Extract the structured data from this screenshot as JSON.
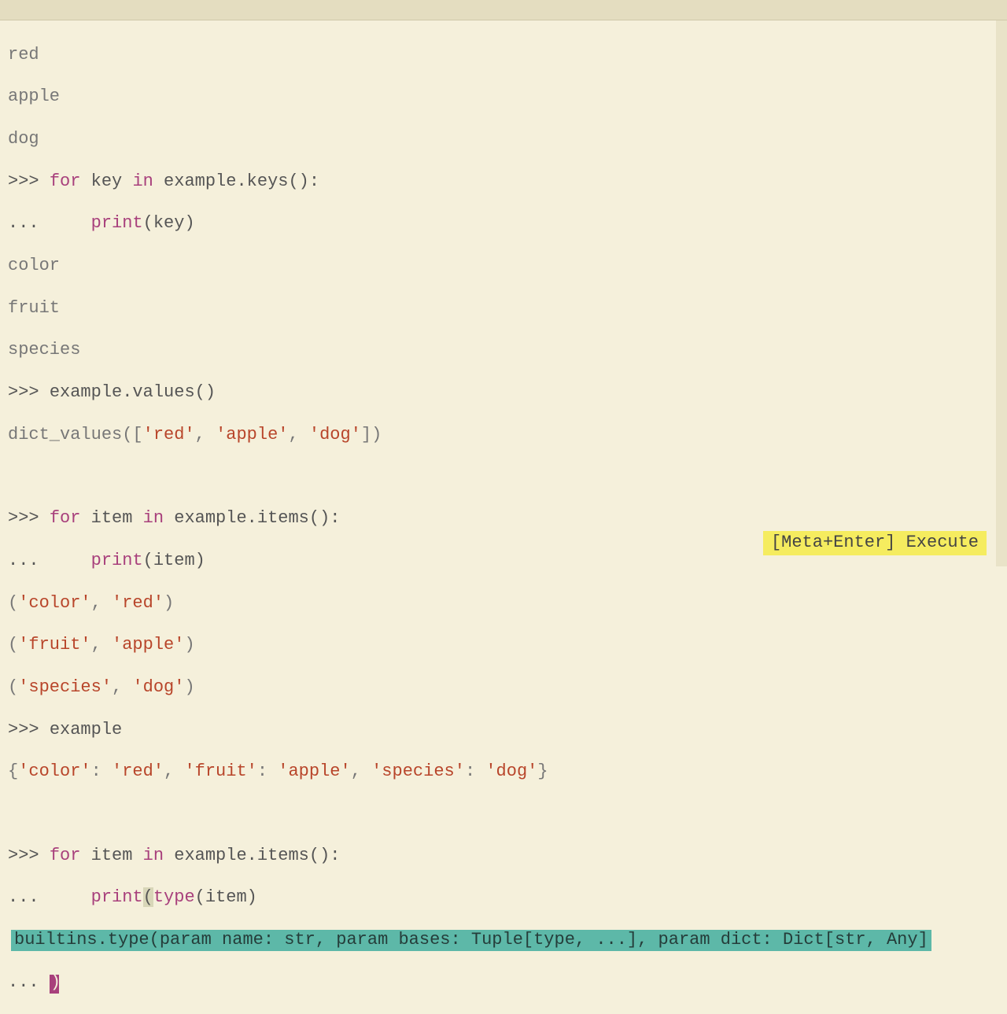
{
  "titlebar": "",
  "lines": {
    "out_red": "red",
    "out_apple": "apple",
    "out_dog": "dog",
    "prompt1": ">>> ",
    "for1_for": "for",
    "for1_var": " key ",
    "for1_in": "in",
    "for1_expr": " example.keys",
    "for1_call": "():",
    "cont1": "...     ",
    "print1": "print",
    "print1_arg_open": "(",
    "print1_arg": "key",
    "print1_arg_close": ")",
    "out_color": "color",
    "out_fruit": "fruit",
    "out_species": "species",
    "prompt2": ">>> ",
    "expr2": "example.values()",
    "out_dictvals_pre": "dict_values([",
    "out_dictvals_s1": "'red'",
    "out_dictvals_c1": ", ",
    "out_dictvals_s2": "'apple'",
    "out_dictvals_c2": ", ",
    "out_dictvals_s3": "'dog'",
    "out_dictvals_post": "])",
    "prompt3": ">>> ",
    "for3_for": "for",
    "for3_var": " item ",
    "for3_in": "in",
    "for3_expr": " example.items",
    "for3_call": "():",
    "cont3": "...     ",
    "print3": "print",
    "print3_arg_open": "(",
    "print3_arg": "item",
    "print3_arg_close": ")",
    "out_tuple1_pre": "(",
    "out_tuple1_s1": "'color'",
    "out_tuple1_c": ", ",
    "out_tuple1_s2": "'red'",
    "out_tuple1_post": ")",
    "out_tuple2_pre": "(",
    "out_tuple2_s1": "'fruit'",
    "out_tuple2_c": ", ",
    "out_tuple2_s2": "'apple'",
    "out_tuple2_post": ")",
    "out_tuple3_pre": "(",
    "out_tuple3_s1": "'species'",
    "out_tuple3_c": ", ",
    "out_tuple3_s2": "'dog'",
    "out_tuple3_post": ")",
    "prompt4": ">>> ",
    "expr4": "example",
    "out_dict_pre": "{",
    "out_dict_k1": "'color'",
    "out_dict_sep1": ": ",
    "out_dict_v1": "'red'",
    "out_dict_c1": ", ",
    "out_dict_k2": "'fruit'",
    "out_dict_sep2": ": ",
    "out_dict_v2": "'apple'",
    "out_dict_c2": ", ",
    "out_dict_k3": "'species'",
    "out_dict_sep3": ": ",
    "out_dict_v3": "'dog'",
    "out_dict_post": "}",
    "prompt5": ">>> ",
    "for5_for": "for",
    "for5_var": " item ",
    "for5_in": "in",
    "for5_expr": " example.items",
    "for5_call": "():",
    "cont5": "...     ",
    "print5": "print",
    "print5_open": "(",
    "type5": "type",
    "type5_open": "(",
    "type5_arg": "item",
    "type5_close": ")",
    "hint_text": "builtins.type(param name: str, param bases: Tuple[type, ...], param dict: Dict[str, Any]",
    "cont6": "... ",
    "cursor_char": ")"
  },
  "exec_hint": "[Meta+Enter] Execute"
}
